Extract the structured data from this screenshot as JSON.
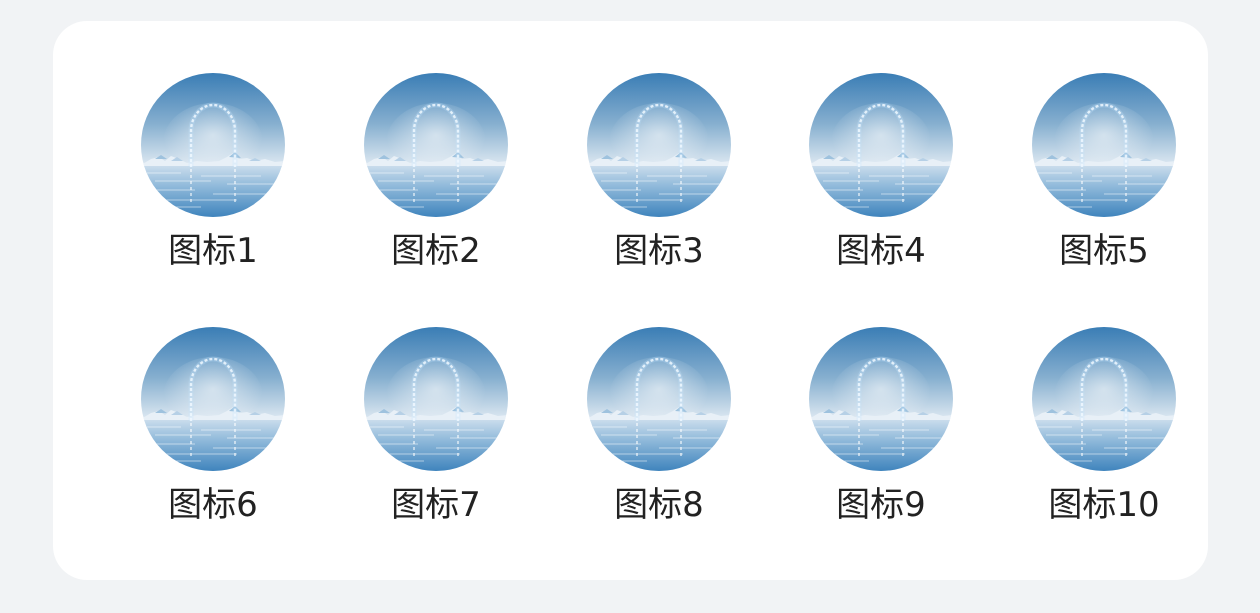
{
  "icons": [
    {
      "label": "图标1"
    },
    {
      "label": "图标2"
    },
    {
      "label": "图标3"
    },
    {
      "label": "图标4"
    },
    {
      "label": "图标5"
    },
    {
      "label": "图标6"
    },
    {
      "label": "图标7"
    },
    {
      "label": "图标8"
    },
    {
      "label": "图标9"
    },
    {
      "label": "图标10"
    }
  ],
  "icon_image": "ocean-arch-picture",
  "colors": {
    "page_background": "#f1f3f5",
    "card_background": "#ffffff",
    "label_text": "#222222",
    "sky_top": "#3a7db5",
    "sky_bottom": "#d7e4ef",
    "water": "#6fa3cc"
  }
}
